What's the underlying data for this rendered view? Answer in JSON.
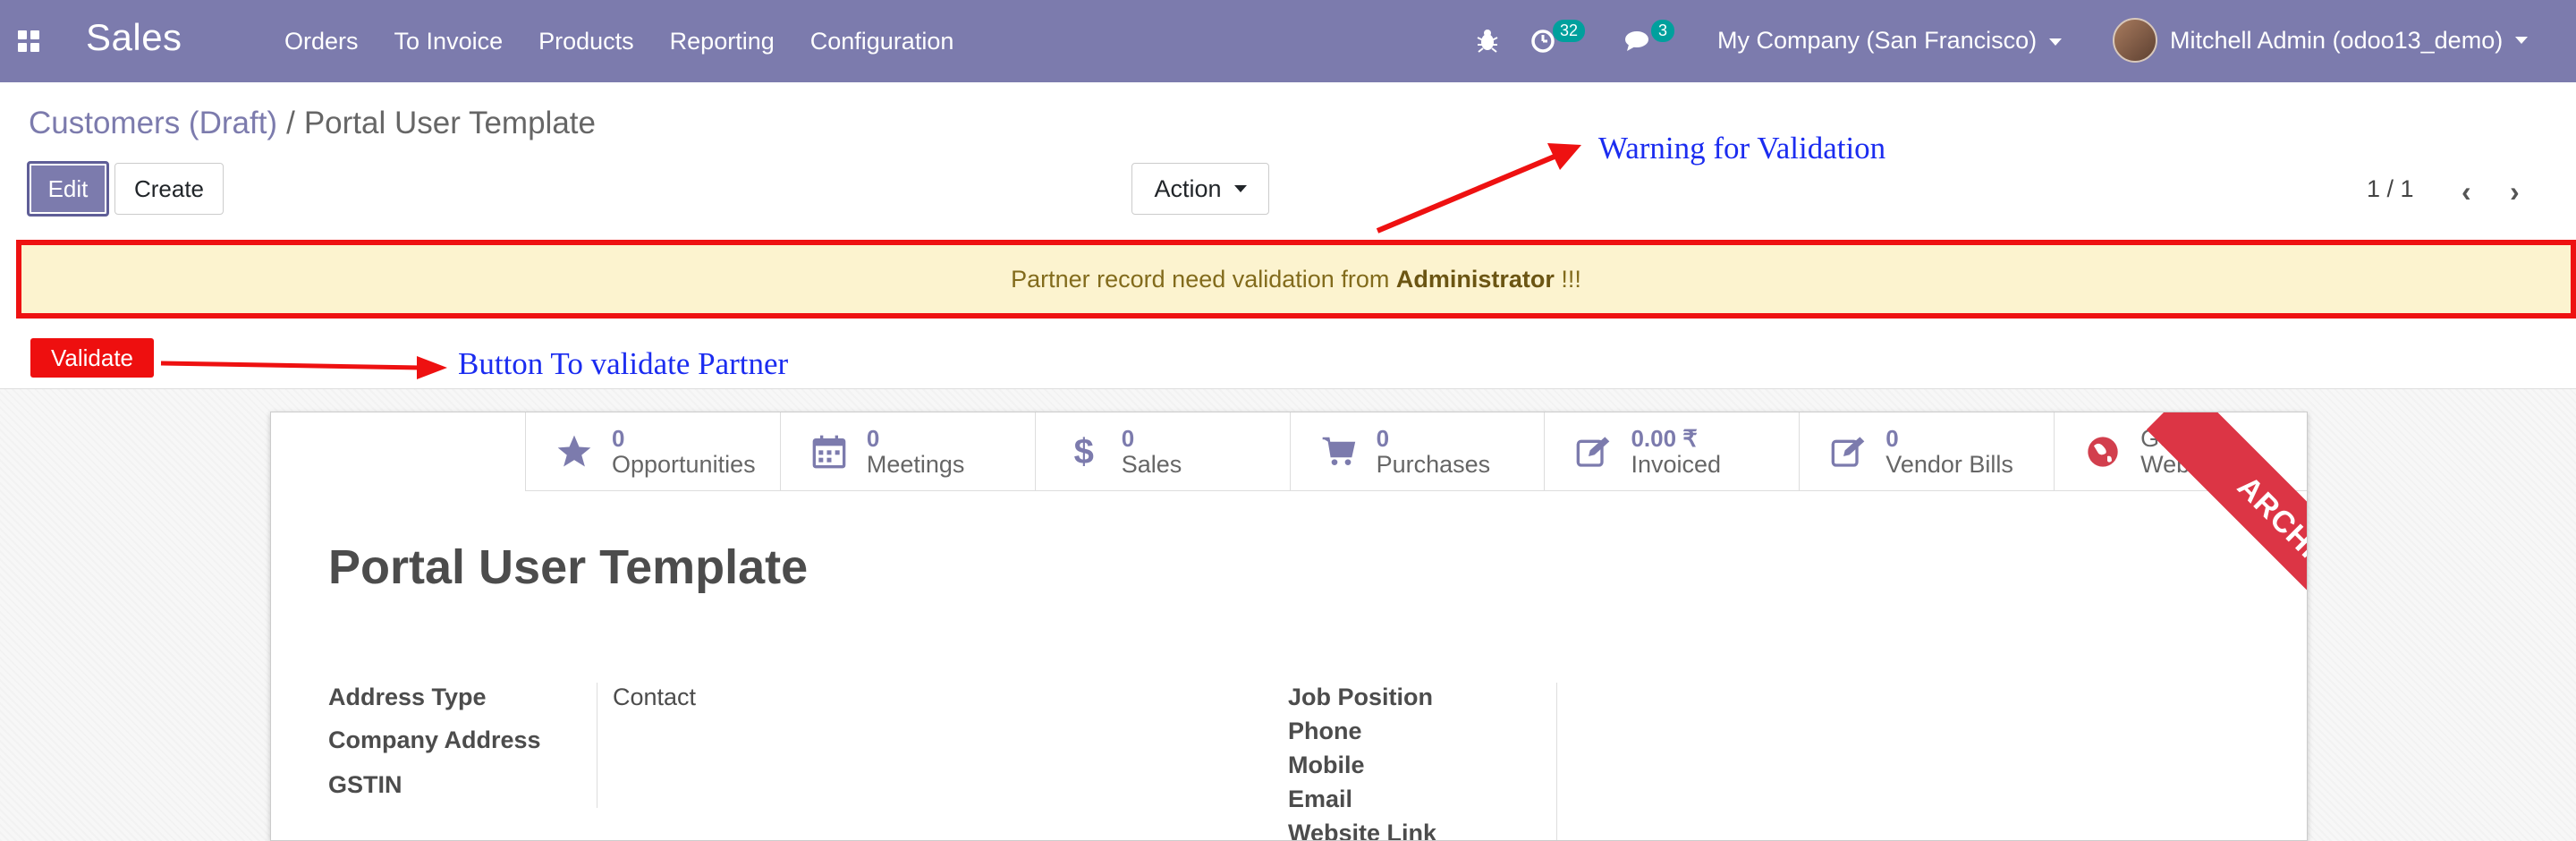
{
  "navbar": {
    "brand": "Sales",
    "menu": [
      "Orders",
      "To Invoice",
      "Products",
      "Reporting",
      "Configuration"
    ],
    "activity_count": "32",
    "message_count": "3",
    "company": "My Company (San Francisco)",
    "user": "Mitchell Admin (odoo13_demo)"
  },
  "breadcrumb": {
    "parent": "Customers (Draft)",
    "separator": "/",
    "current": "Portal User Template"
  },
  "buttons": {
    "edit": "Edit",
    "create": "Create",
    "action": "Action",
    "validate": "Validate"
  },
  "pager": "1 / 1",
  "warning": {
    "prefix": "Partner record need validation from ",
    "bold": "Administrator",
    "suffix": " !!!"
  },
  "annotations": {
    "warning": "Warning for Validation",
    "button": "Button To validate Partner"
  },
  "smart_buttons": [
    {
      "value": "0",
      "label": "Opportunities",
      "icon": "star-icon"
    },
    {
      "value": "0",
      "label": "Meetings",
      "icon": "calendar-icon"
    },
    {
      "value": "0",
      "label": "Sales",
      "icon": "dollar-icon"
    },
    {
      "value": "0",
      "label": "Purchases",
      "icon": "cart-icon"
    },
    {
      "value": "0.00 ₹",
      "label": "Invoiced",
      "icon": "edit-icon"
    },
    {
      "value": "0",
      "label": "Vendor Bills",
      "icon": "edit-icon"
    },
    {
      "value": "Go to",
      "label": "Website",
      "icon": "globe-icon"
    }
  ],
  "record": {
    "title": "Portal User Template",
    "ribbon": "ARCHIVED"
  },
  "fields_left": [
    {
      "label": "Address Type",
      "value": "Contact"
    },
    {
      "label": "Company Address",
      "value": ""
    },
    {
      "label": "GSTIN",
      "value": ""
    }
  ],
  "fields_right": [
    {
      "label": "Job Position"
    },
    {
      "label": "Phone"
    },
    {
      "label": "Mobile"
    },
    {
      "label": "Email"
    },
    {
      "label": "Website Link"
    }
  ],
  "colors": {
    "navbar": "#7c7bad",
    "warning_border": "#ee1111",
    "warning_bg": "#fcf3cf",
    "validate_button": "#ee0f0f",
    "annotation_text": "#1b2cf0",
    "ribbon": "#dc3545"
  }
}
